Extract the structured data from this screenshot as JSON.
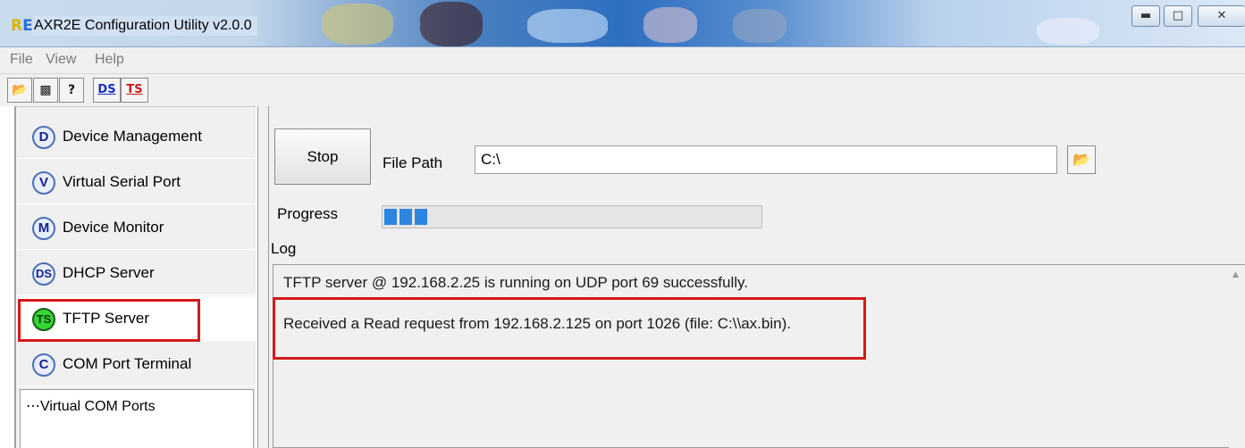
{
  "window": {
    "title": "AXR2E Configuration Utility v2.0.0",
    "icon": "app-logo",
    "controls": [
      "minimize-icon",
      "maximize-icon",
      "close-icon"
    ]
  },
  "menu": {
    "items": [
      "File",
      "View",
      "Help"
    ]
  },
  "toolbar": {
    "buttons": [
      {
        "name": "open-folder-icon",
        "glyph": "📂"
      },
      {
        "name": "save-icon",
        "glyph": "💾"
      },
      {
        "name": "help-icon",
        "glyph": "?"
      },
      {
        "name": "dhcp-server-icon",
        "label": "DS"
      },
      {
        "name": "tftp-server-icon",
        "label": "TS"
      }
    ]
  },
  "sidebar": {
    "items": [
      {
        "badge": "D",
        "label": "Device Management"
      },
      {
        "badge": "V",
        "label": "Virtual Serial Port"
      },
      {
        "badge": "M",
        "label": "Device Monitor"
      },
      {
        "badge": "DS",
        "label": "DHCP Server"
      },
      {
        "badge": "TS",
        "label": "TFTP Server",
        "selected": true
      },
      {
        "badge": "C",
        "label": "COM Port Terminal"
      }
    ],
    "tree": {
      "root": "Virtual COM Ports"
    }
  },
  "tftp": {
    "stop_label": "Stop",
    "file_path_label": "File Path",
    "file_path_value": "C:\\",
    "progress_label": "Progress",
    "progress_fraction": 0.11,
    "log_label": "Log",
    "log_lines": [
      "TFTP server @ 192.168.2.25 is running on UDP port 69 successfully.",
      "Received a Read request from 192.168.2.125 on port 1026 (file: C:\\\\ax.bin)."
    ]
  },
  "colors": {
    "highlight_box": "#d41a1a",
    "active_badge": "#33d633",
    "progress": "#2a86e0"
  }
}
